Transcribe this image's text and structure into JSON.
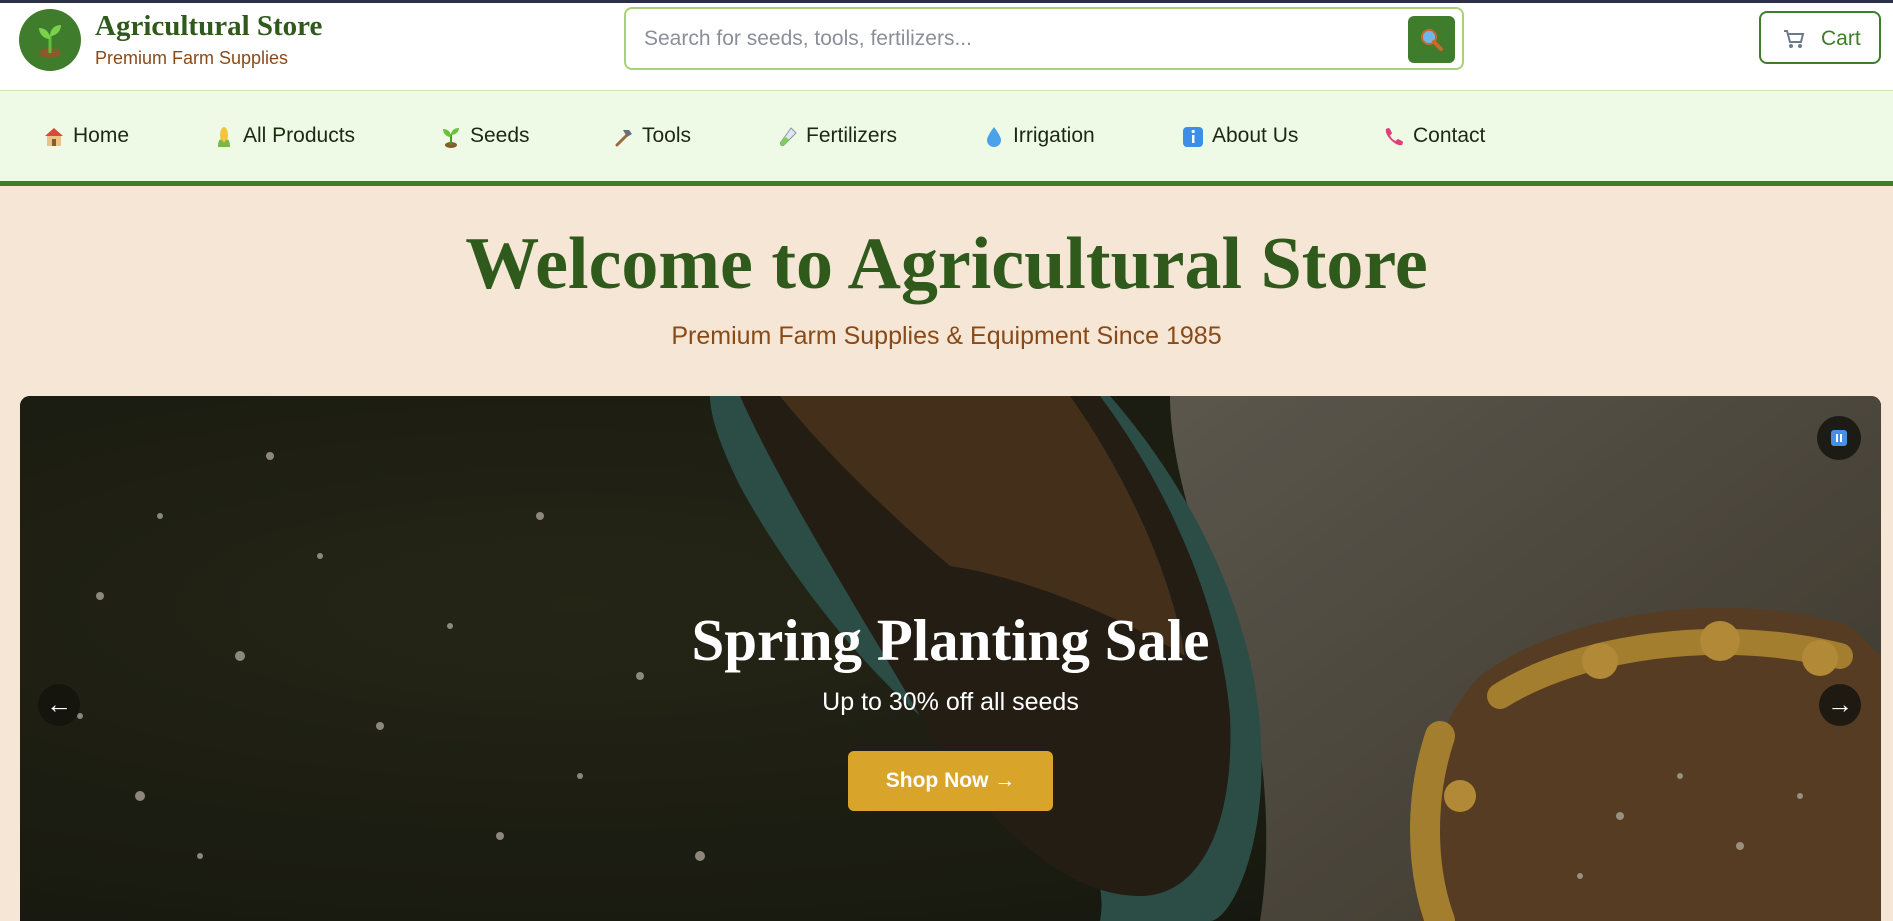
{
  "header": {
    "brand_title": "Agricultural Store",
    "brand_subtitle": "Premium Farm Supplies",
    "logo_icon": "seedling-icon",
    "search_placeholder": "Search for seeds, tools, fertilizers...",
    "search_value": "",
    "search_icon": "magnifier-icon",
    "cart_label": "Cart",
    "cart_icon": "shopping-cart-icon"
  },
  "nav": {
    "items": [
      {
        "label": "Home",
        "icon": "house-icon"
      },
      {
        "label": "All Products",
        "icon": "corn-icon"
      },
      {
        "label": "Seeds",
        "icon": "seedling-icon"
      },
      {
        "label": "Tools",
        "icon": "hammer-icon"
      },
      {
        "label": "Fertilizers",
        "icon": "test-tube-icon"
      },
      {
        "label": "Irrigation",
        "icon": "droplet-icon"
      },
      {
        "label": "About Us",
        "icon": "info-icon"
      },
      {
        "label": "Contact",
        "icon": "phone-icon"
      }
    ]
  },
  "hero": {
    "title": "Welcome to Agricultural Store",
    "tagline": "Premium Farm Supplies & Equipment Since 1985"
  },
  "slider": {
    "slide_title": "Spring Planting Sale",
    "slide_subtitle": "Up to 30% off all seeds",
    "cta_label": "Shop Now →",
    "prev_label": "←",
    "next_label": "→",
    "pause_icon": "pause-icon"
  },
  "colors": {
    "brand_green": "#3f7d2c",
    "dark_green_text": "#2f5a1c",
    "brown_text": "#8a4a18",
    "page_bg": "#f5e6d6",
    "nav_bg": "#eefae6",
    "cta_gold": "#d9a42a"
  }
}
